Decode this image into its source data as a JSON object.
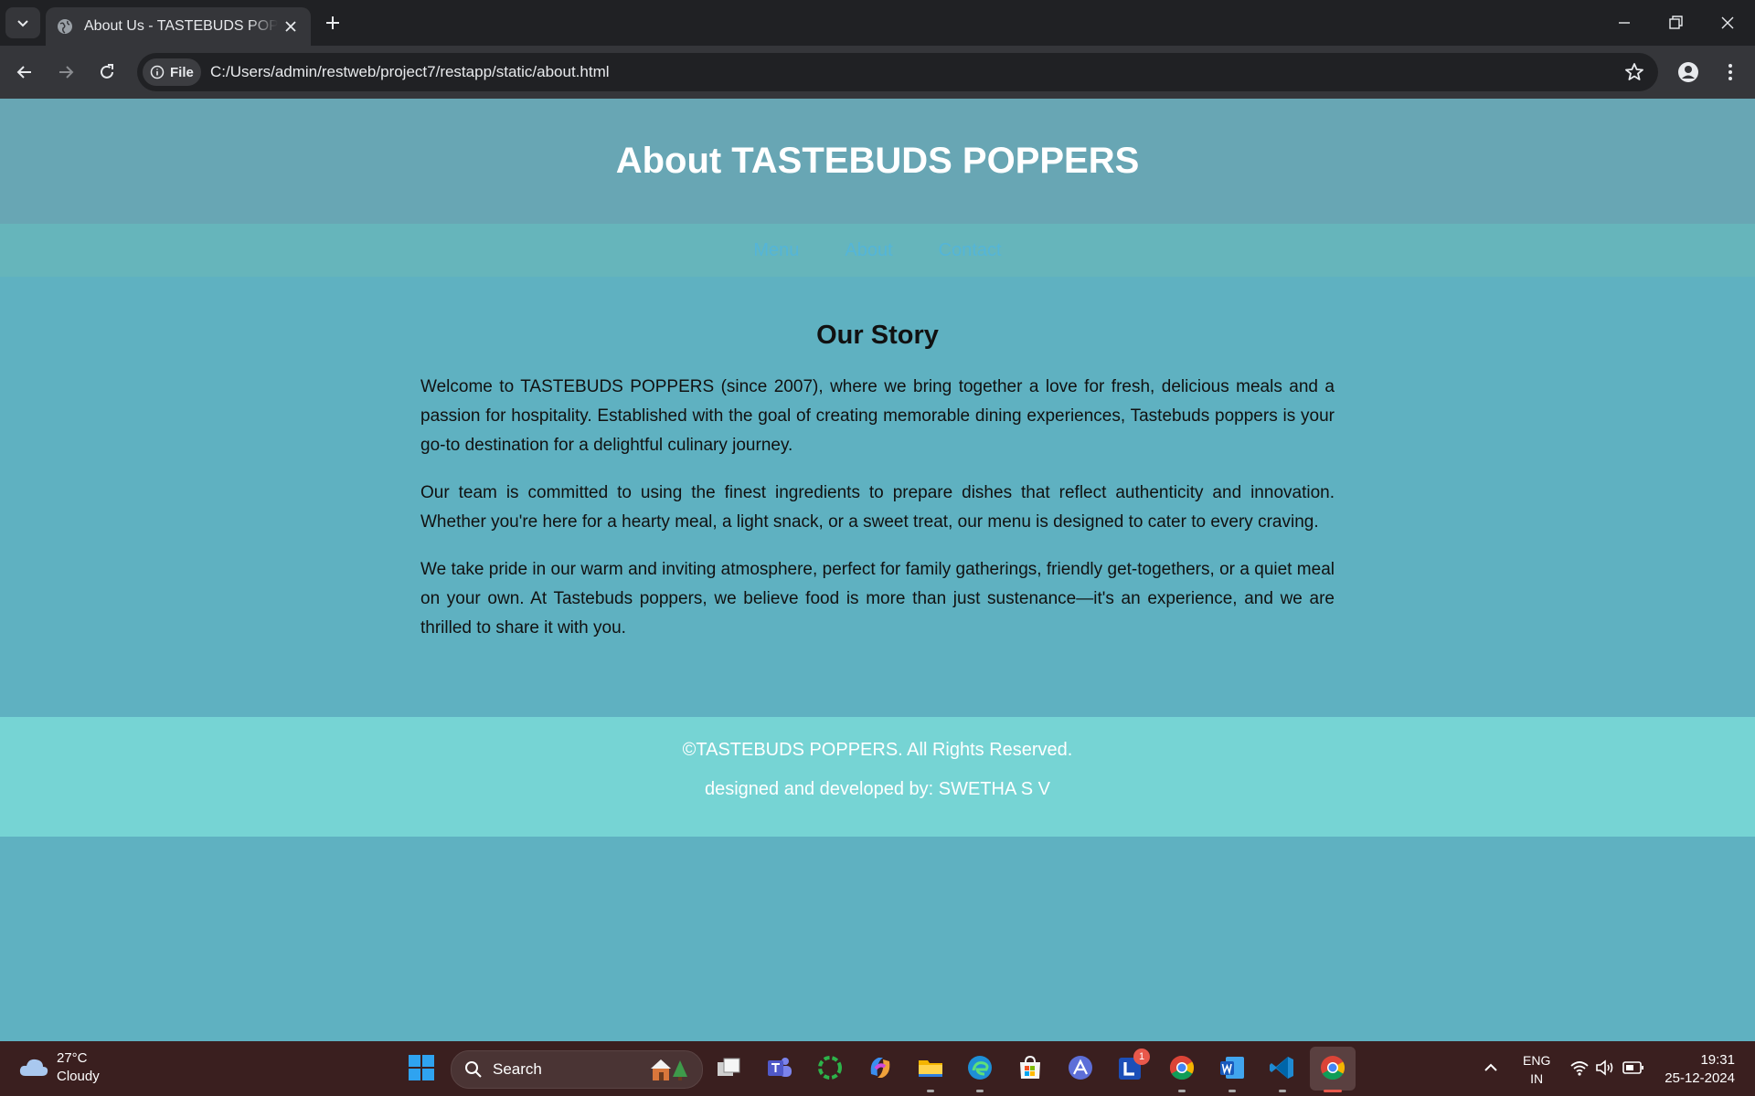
{
  "browser": {
    "tab_title": "About Us - TASTEBUDS POPPERS",
    "site_chip": "File",
    "url": "C:/Users/admin/restweb/project7/restapp/static/about.html"
  },
  "page": {
    "header_title": "About TASTEBUDS POPPERS",
    "nav": [
      "Menu",
      "About",
      "Contact"
    ],
    "story_heading": "Our Story",
    "paragraphs": [
      "Welcome to TASTEBUDS POPPERS (since 2007), where we bring together a love for fresh, delicious meals and a passion for hospitality. Established with the goal of creating memorable dining experiences, Tastebuds poppers is your go-to destination for a delightful culinary journey.",
      "Our team is committed to using the finest ingredients to prepare dishes that reflect authenticity and innovation. Whether you're here for a hearty meal, a light snack, or a sweet treat, our menu is designed to cater to every craving.",
      "We take pride in our warm and inviting atmosphere, perfect for family gatherings, friendly get-togethers, or a quiet meal on your own. At Tastebuds poppers, we believe food is more than just sustenance—it's an experience, and we are thrilled to share it with you."
    ],
    "footer_copyright": "©TASTEBUDS POPPERS. All Rights Reserved.",
    "footer_credit": "designed and developed by: SWETHA S V"
  },
  "taskbar": {
    "weather_temp": "27°C",
    "weather_desc": "Cloudy",
    "search_label": "Search",
    "lang_1": "ENG",
    "lang_2": "IN",
    "time": "19:31",
    "date": "25-12-2024",
    "notification_badge": "1"
  },
  "colors": {
    "header_bg": "#68a6b4",
    "nav_bg": "#66b5bb",
    "nav_link": "#54b5d8",
    "body_bg": "#5fb1c1",
    "footer_bg": "#76d4d4"
  }
}
